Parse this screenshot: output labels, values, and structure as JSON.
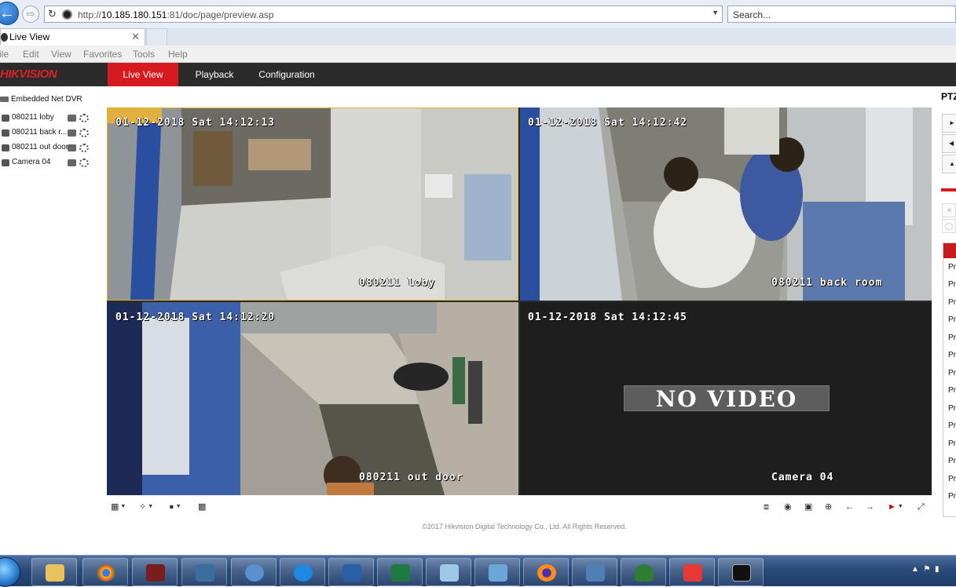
{
  "browser": {
    "url_prefix": "http://",
    "url_host": "10.185.180.151",
    "url_rest": ":81/doc/page/preview.asp",
    "search_placeholder": "Search...",
    "tab_title": "Live View",
    "menu": [
      "ile",
      "Edit",
      "View",
      "Favorites",
      "Tools",
      "Help"
    ]
  },
  "app": {
    "logo": "HIKVISION",
    "nav": [
      "Live View",
      "Playback",
      "Configuration"
    ],
    "active_nav": "Live View",
    "copyright": "©2017 Hikvision Digital Technology Co., Ltd. All Rights Reserved."
  },
  "tree": {
    "root": "Embedded Net DVR",
    "cameras": [
      "080211 loby",
      "080211 back r...",
      "080211 out door",
      "Camera 04"
    ]
  },
  "cells": [
    {
      "timestamp": "01-12-2018 Sat 14:12:13",
      "name": "080211 loby"
    },
    {
      "timestamp": "01-12-2018 Sat 14:12:42",
      "name": "080211 back room"
    },
    {
      "timestamp": "01-12-2018 Sat 14:12:20",
      "name": "080211 out door"
    },
    {
      "timestamp": "01-12-2018 Sat 14:12:45",
      "name": "Camera 04",
      "status": "NO VIDEO"
    }
  ],
  "ptz": {
    "title": "PTZ",
    "preset_items": [
      "Pr",
      "Pr",
      "Pr",
      "Pr",
      "Pr",
      "Pr",
      "Pr",
      "Pr",
      "Pr",
      "Pr",
      "Pr",
      "Pr",
      "Pr",
      "Pr"
    ]
  },
  "controls": {
    "left_icons": [
      "window-layout-icon",
      "ptz-icon",
      "microphone-icon",
      "capture-icon"
    ],
    "right_icons": [
      "stop-all-icon",
      "snapshot-icon",
      "record-icon",
      "zoom-icon",
      "prev-page-icon",
      "next-page-icon",
      "volume-icon",
      "fullscreen-icon"
    ]
  },
  "taskbar": {
    "apps": [
      "explorer",
      "chrome",
      "app-1",
      "app-2",
      "app-3",
      "internet-explorer",
      "remote-desktop",
      "excel",
      "app-4",
      "control-panel",
      "firefox",
      "app-5",
      "app-6",
      "app-7",
      "command-prompt"
    ]
  },
  "colors": {
    "accent": "#d71920",
    "header": "#2b2b2b",
    "selection": "#e3b325"
  }
}
